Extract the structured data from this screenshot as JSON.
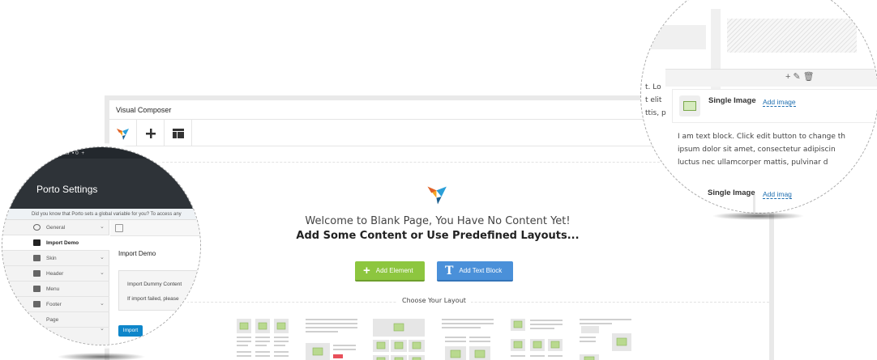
{
  "window": {
    "title": "Visual Composer"
  },
  "toolbar": {
    "items": [
      "vc-logo-icon",
      "plus-icon",
      "templates-icon"
    ]
  },
  "welcome": {
    "line1": "Welcome to Blank Page, You Have No Content Yet!",
    "line2": "Add Some Content or Use Predefined Layouts..."
  },
  "buttons": {
    "add_element": "Add Element",
    "add_text_block": "Add Text Block"
  },
  "layouts": {
    "heading": "Choose Your Layout"
  },
  "porto": {
    "top_bar": "Options",
    "title": "Porto Settings",
    "notice": "Did you know that Porto sets a global variable for you? To access any",
    "sidebar": [
      "General",
      "Import Demo",
      "Skin",
      "Header",
      "Menu",
      "Footer",
      "Page"
    ],
    "panel_title": "Import Demo",
    "box_line1": "Import Dummy Content",
    "box_line2": "If import failed, please",
    "import_button": "Import"
  },
  "zoom": {
    "partial1": "t. Lo",
    "partial2": "t elit",
    "partial3": "ttis, p",
    "widget_title": "Single Image",
    "add_image": "Add image",
    "text_line1": "I am text block. Click edit button to change th",
    "text_line2": "ipsum dolor sit amet, consectetur adipiscin",
    "text_line3": "luctus nec ullamcorper mattis, pulvinar d",
    "widget2_title": "Single Image",
    "add_image2": "Add imag"
  },
  "colors": {
    "green": "#8dc63f",
    "blue": "#4a90d9",
    "porto_dark": "#2e3338",
    "link": "#1f6fb0"
  }
}
